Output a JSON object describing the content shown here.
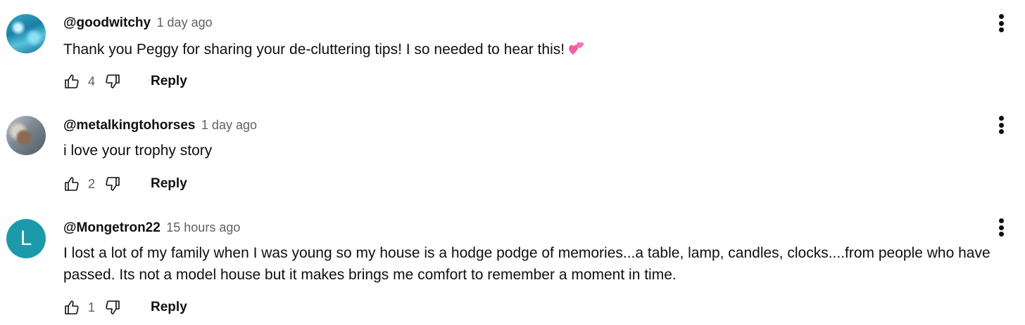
{
  "comments": [
    {
      "author": "@goodwitchy",
      "time": "1 day ago",
      "text": "Thank you Peggy for sharing your de-cluttering tips! I so needed to hear this!",
      "emoji": "two-hearts",
      "likes": "4",
      "reply_label": "Reply",
      "avatar": "water-photo"
    },
    {
      "author": "@metalkingtohorses",
      "time": "1 day ago",
      "text": "i love your trophy story",
      "likes": "2",
      "reply_label": "Reply",
      "avatar": "horse-photo"
    },
    {
      "author": "@Mongetron22",
      "time": "15 hours ago",
      "text": "I lost a lot of my family when I was young so my house is a hodge podge of memories...a table, lamp, candles, clocks....from people who have passed. Its not a model house but it makes brings me comfort to remember a moment in time.",
      "likes": "1",
      "reply_label": "Reply",
      "avatar_letter": "L",
      "avatar_color": "#1b9aaa"
    }
  ],
  "icons": {
    "like": "thumbs-up-icon",
    "dislike": "thumbs-down-icon",
    "menu": "more-vertical-icon"
  },
  "colors": {
    "text": "#0f0f0f",
    "secondary": "#606060",
    "emoji_pink": "#f25fa4"
  }
}
